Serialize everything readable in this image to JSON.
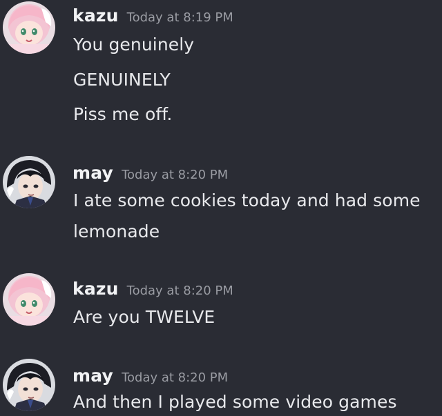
{
  "messages": [
    {
      "author": "kazu",
      "timestamp": "Today at 8:19 PM",
      "avatar_icon": "pink-hair-anime-avatar",
      "lines": [
        "You genuinely",
        "GENUINELY",
        "Piss me off."
      ]
    },
    {
      "author": "may",
      "timestamp": "Today at 8:20 PM",
      "avatar_icon": "dark-hair-anime-avatar",
      "lines": [
        "I ate some cookies today and had some",
        "lemonade"
      ]
    },
    {
      "author": "kazu",
      "timestamp": "Today at 8:20 PM",
      "avatar_icon": "pink-hair-anime-avatar",
      "lines": [
        "Are you TWELVE"
      ]
    },
    {
      "author": "may",
      "timestamp": "Today at 8:20 PM",
      "avatar_icon": "dark-hair-anime-avatar",
      "lines": [
        "And then I played some video games"
      ]
    }
  ],
  "colors": {
    "background": "#2a2c34",
    "username": "#f2f3f5",
    "timestamp": "#9a9ca3",
    "message_text": "#e8e9ec"
  }
}
